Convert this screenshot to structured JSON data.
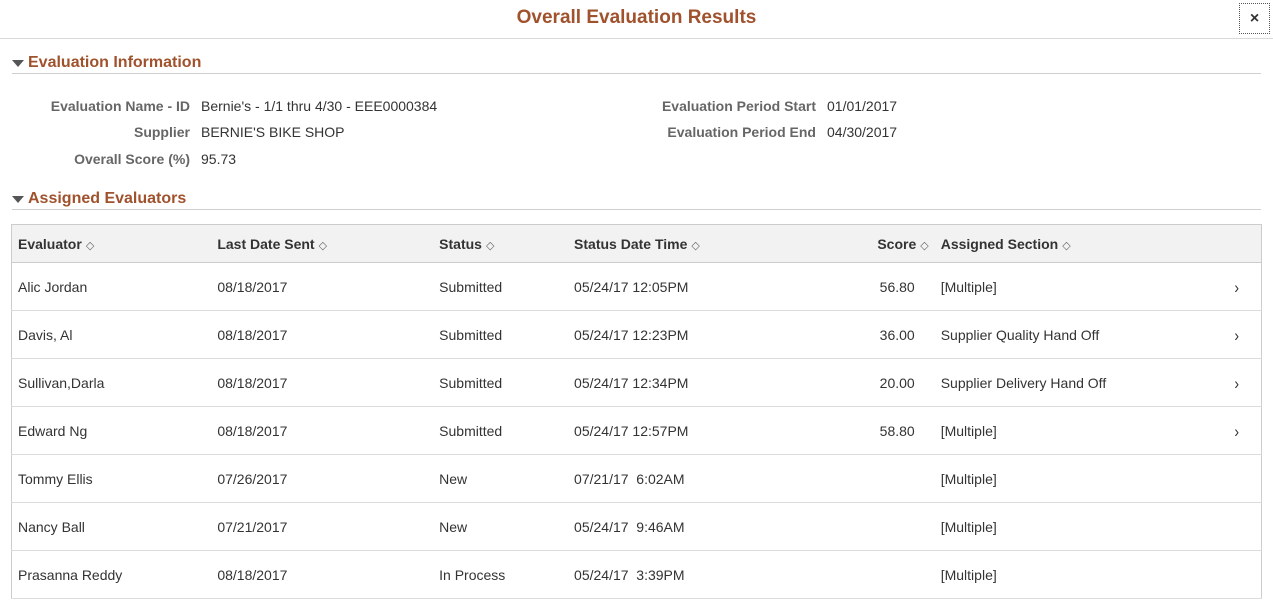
{
  "window": {
    "title": "Overall Evaluation Results",
    "close_glyph": "×"
  },
  "evaluation_info": {
    "section_title": "Evaluation Information",
    "name_label": "Evaluation Name - ID",
    "name_value": "Bernie's - 1/1 thru 4/30 - EEE0000384",
    "supplier_label": "Supplier",
    "supplier_value": "BERNIE'S BIKE SHOP",
    "score_label": "Overall Score (%)",
    "score_value": "95.73",
    "period_start_label": "Evaluation Period Start",
    "period_start_value": "01/01/2017",
    "period_end_label": "Evaluation Period End",
    "period_end_value": "04/30/2017"
  },
  "evaluators": {
    "section_title": "Assigned Evaluators",
    "columns": [
      "Evaluator",
      "Last Date Sent",
      "Status",
      "Status Date Time",
      "Score",
      "Assigned Section"
    ],
    "sort_glyph": "◇",
    "chevron_glyph": "›",
    "rows": [
      {
        "evaluator": "Alic Jordan",
        "last_sent": "08/18/2017",
        "status": "Submitted",
        "status_dt": "05/24/17 12:05PM",
        "score": "56.80",
        "section": "[Multiple]",
        "has_detail": true
      },
      {
        "evaluator": "Davis, Al",
        "last_sent": "08/18/2017",
        "status": "Submitted",
        "status_dt": "05/24/17 12:23PM",
        "score": "36.00",
        "section": "Supplier Quality Hand Off",
        "has_detail": true
      },
      {
        "evaluator": "Sullivan,Darla",
        "last_sent": "08/18/2017",
        "status": "Submitted",
        "status_dt": "05/24/17 12:34PM",
        "score": "20.00",
        "section": "Supplier Delivery Hand Off",
        "has_detail": true
      },
      {
        "evaluator": "Edward Ng",
        "last_sent": "08/18/2017",
        "status": "Submitted",
        "status_dt": "05/24/17 12:57PM",
        "score": "58.80",
        "section": "[Multiple]",
        "has_detail": true
      },
      {
        "evaluator": "Tommy Ellis",
        "last_sent": "07/26/2017",
        "status": "New",
        "status_dt": "07/21/17  6:02AM",
        "score": "",
        "section": "[Multiple]",
        "has_detail": false
      },
      {
        "evaluator": "Nancy Ball",
        "last_sent": "07/21/2017",
        "status": "New",
        "status_dt": "05/24/17  9:46AM",
        "score": "",
        "section": "[Multiple]",
        "has_detail": false
      },
      {
        "evaluator": "Prasanna Reddy",
        "last_sent": "08/18/2017",
        "status": "In Process",
        "status_dt": "05/24/17  3:39PM",
        "score": "",
        "section": "[Multiple]",
        "has_detail": false
      }
    ]
  }
}
